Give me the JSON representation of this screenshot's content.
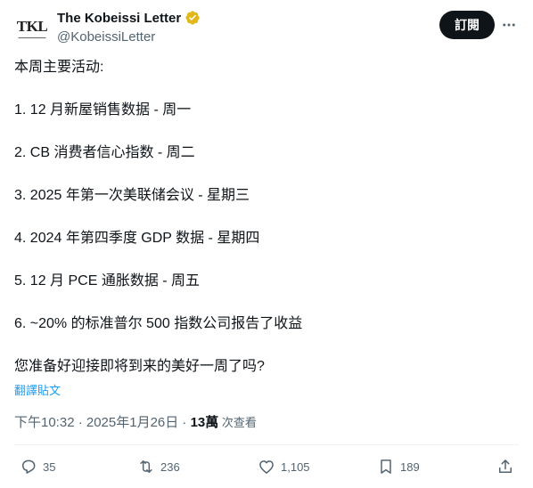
{
  "author": {
    "avatar_text": "TKL",
    "display_name": "The Kobeissi Letter",
    "handle": "@KobeissiLetter",
    "verified_badge_color": "#e2b719"
  },
  "header": {
    "subscribe_label": "訂閱",
    "more_icon": "more-horizontal-icon"
  },
  "tweet": {
    "lines": [
      "本周主要活动:",
      "1. 12 月新屋销售数据 - 周一",
      "2. CB 消费者信心指数 - 周二",
      "3. 2025 年第一次美联储会议 - 星期三",
      "4. 2024 年第四季度 GDP 数据 - 星期四",
      "5. 12 月 PCE 通胀数据 - 周五",
      "6. ~20% 的标准普尔 500 指数公司报告了收益",
      "您准备好迎接即将到来的美好一周了吗?"
    ],
    "translate_label": "翻譯貼文"
  },
  "meta": {
    "timestamp": "下午10:32 · 2025年1月26日 · ",
    "views_count": "13萬",
    "views_label": " 次查看"
  },
  "actions": {
    "replies": "35",
    "reposts": "236",
    "likes": "1,105",
    "bookmarks": "189"
  },
  "colors": {
    "text_primary": "#0f1419",
    "text_secondary": "#536471",
    "link": "#1d9bf0",
    "divider": "#eff3f4"
  }
}
